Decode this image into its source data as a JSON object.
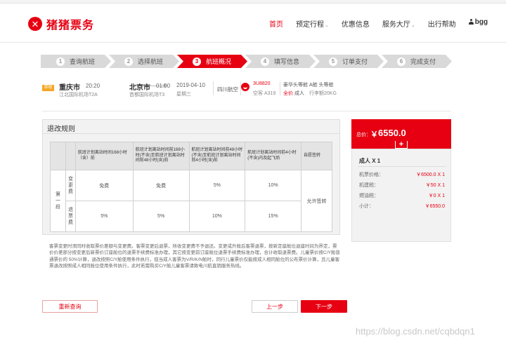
{
  "brand": {
    "mark": "✕",
    "name": "猪猪票务"
  },
  "nav": {
    "home": "首页",
    "booking": "预定行程",
    "offers": "优惠信息",
    "service": "服务大厅",
    "help": "出行帮助",
    "user": "bgg"
  },
  "steps": [
    {
      "num": "1",
      "label": "查询航班"
    },
    {
      "num": "2",
      "label": "选择航班"
    },
    {
      "num": "3",
      "label": "航班概况"
    },
    {
      "num": "4",
      "label": "填写信息"
    },
    {
      "num": "5",
      "label": "订单支付"
    },
    {
      "num": "6",
      "label": "完成支付"
    }
  ],
  "flight": {
    "tag": "单程",
    "dep_city": "重庆市",
    "dep_time": "20:20",
    "dep_airport": "江北国际机场T2A",
    "arr_city": "北京市",
    "arr_time": "01:00",
    "arr_airport": "首都国际机场T3",
    "date": "2019-04-10",
    "weekday": "星期三",
    "airline": "四川航空",
    "flight_no": "3U8820",
    "aircraft": "空客 A319",
    "cabin": "豪华头等舱 A舱 头等舱",
    "price_type": "全价",
    "passenger": "成人",
    "baggage": "行李额20KG"
  },
  "rules": {
    "title": "退改规则",
    "headers": [
      "",
      "",
      "航班计划离站时间168小时（含）前",
      "航班计划离站时间前168小时(不含)至航班计划离站时间前48小时(含)前",
      "航班计划离站时间前48小时(不含)至航班计划离站时间前4小时(含)前",
      "航班计划离站时间前4小时(不含)内及起飞后",
      "自愿签转"
    ],
    "segment": "第一段",
    "change_label": "变更费",
    "refund_label": "退票费",
    "change": [
      "免费",
      "免费",
      "5%",
      "10%"
    ],
    "refund": [
      "5%",
      "5%",
      "10%",
      "15%"
    ],
    "endorse": "允许签转",
    "notes": "客票变更时须同时收取票价差额与变更费。客票变更后退票，所收变更费不予退还。变更或升舱后客票退票，按新定座舱位退座时间为界定，票价价差部分按变更后新票价订座舱位的退票手续费标准办理，其它按变更前订座舱位退票手续费标准办理，合计收取退票费。儿童票价按C/Y舱普通票价的 50%计算，退改按照C/Y舱使用条件执行，但当成人客票为V/R/K/N舱时，同行儿童票价仅能按成人相同舱位的公布票价计算，且儿童客票退改按照成人相同舱位使用条件执行，此时若需购买C/Y舱儿童客票请致电川航直销服务热线。"
  },
  "buttons": {
    "reset": "重新查询",
    "prev": "上一步",
    "next": "下一步"
  },
  "price": {
    "label": "总价：",
    "symbol": "￥",
    "total": "6550.0",
    "plus": "+",
    "passenger_title": "成人 X 1",
    "rows": [
      {
        "label": "机票价格：",
        "value": "￥6500.0 X 1"
      },
      {
        "label": "机建税：",
        "value": "￥50 X 1"
      },
      {
        "label": "燃油税：",
        "value": "￥0 X 1"
      },
      {
        "label": "小计：",
        "value": "￥6550.0"
      }
    ]
  },
  "watermark": "https://blog.csdn.net/cqbdqn1",
  "colors": {
    "accent": "#e60012",
    "step_inactive": "#d9d9d9",
    "panel_bg": "#f2f2f2"
  }
}
